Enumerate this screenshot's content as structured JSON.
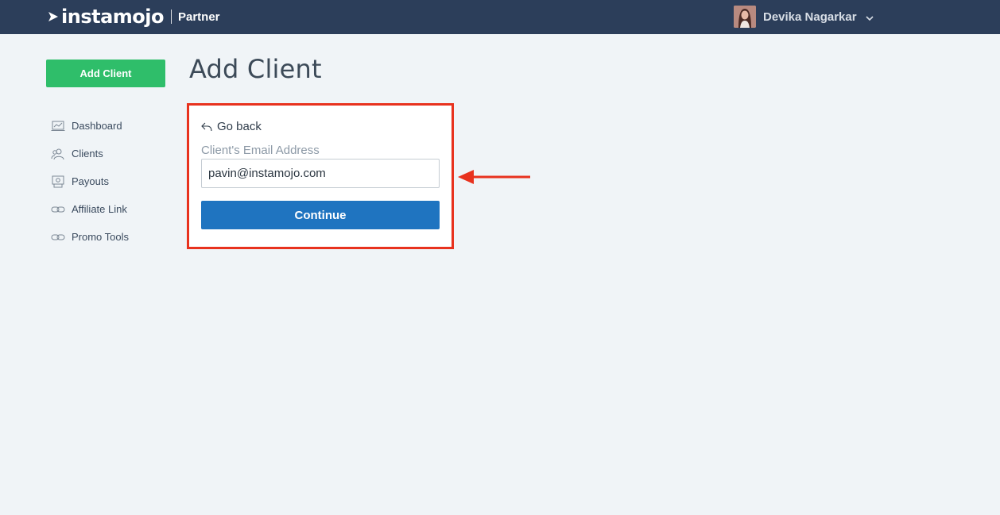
{
  "header": {
    "logo_text": "instamojo",
    "section_label": "Partner",
    "user_name": "Devika Nagarkar"
  },
  "sidebar": {
    "add_client_label": "Add Client",
    "items": [
      {
        "label": "Dashboard",
        "icon": "dashboard-icon"
      },
      {
        "label": "Clients",
        "icon": "clients-icon"
      },
      {
        "label": "Payouts",
        "icon": "payouts-icon"
      },
      {
        "label": "Affiliate Link",
        "icon": "link-icon"
      },
      {
        "label": "Promo Tools",
        "icon": "link-icon"
      }
    ]
  },
  "main": {
    "title": "Add Client",
    "form": {
      "go_back_label": "Go back",
      "email_label": "Client's Email Address",
      "email_value": "pavin@instamojo.com",
      "continue_label": "Continue"
    }
  },
  "colors": {
    "topbar": "#2c3e5a",
    "add_client_green": "#2fbe6a",
    "continue_blue": "#1f74c0",
    "highlight_red": "#e8321e",
    "background": "#f0f4f7"
  }
}
